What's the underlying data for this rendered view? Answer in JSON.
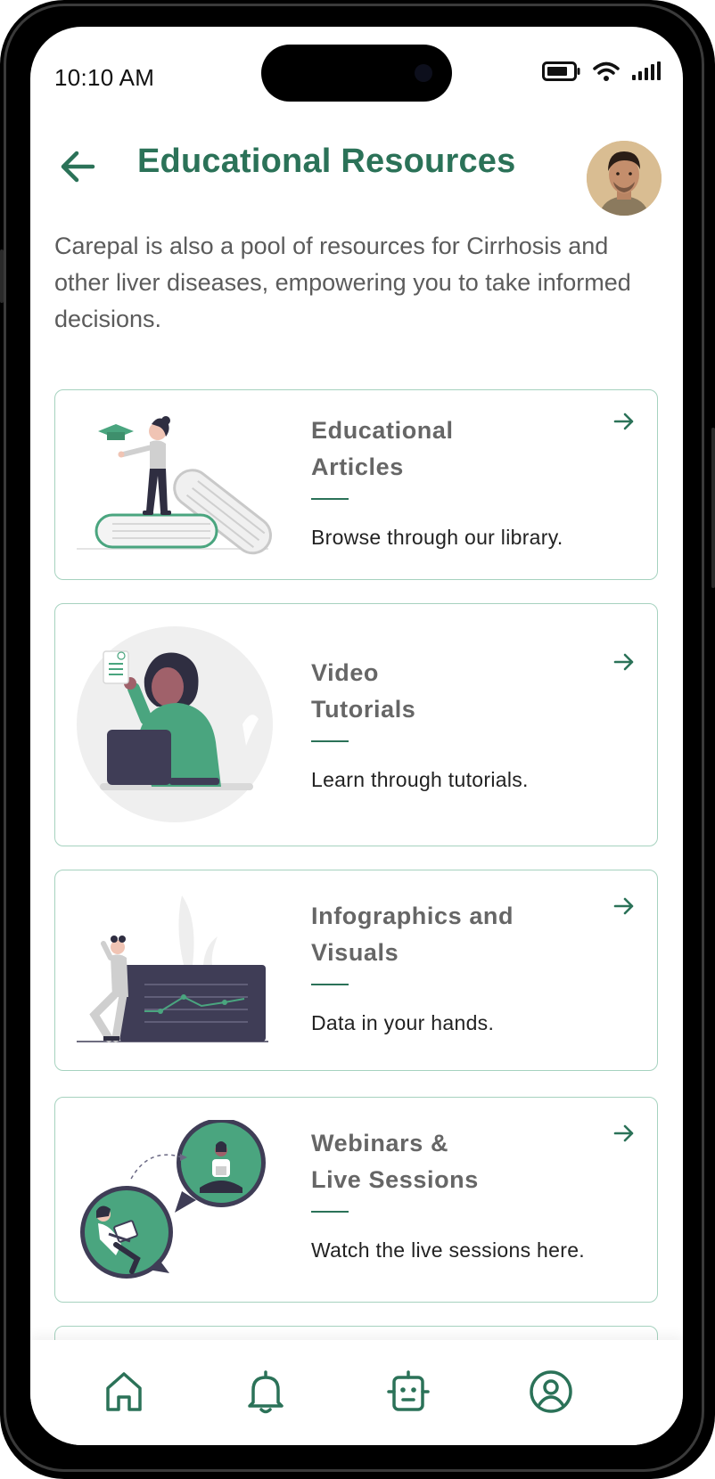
{
  "status": {
    "time": "10:10 AM"
  },
  "header": {
    "title": "Educational Resources"
  },
  "intro": "Carepal is also a pool of resources for Cirrhosis and other liver diseases, empowering you to take informed decisions.",
  "resources": [
    {
      "title_line1": "Educational",
      "title_line2": "Articles",
      "description": "Browse through our library."
    },
    {
      "title_line1": "Video",
      "title_line2": "Tutorials",
      "description": "Learn through tutorials."
    },
    {
      "title_line1": "Infographics and",
      "title_line2": "Visuals",
      "description": "Data in your hands."
    },
    {
      "title_line1": "Webinars &",
      "title_line2": "Live Sessions",
      "description": "Watch the live sessions here."
    }
  ],
  "bottom_nav": [
    "home-icon",
    "bell-icon",
    "robot-icon",
    "profile-icon"
  ],
  "colors": {
    "accent": "#2b7258",
    "card_border": "#a6d2bf",
    "illustration_green": "#4aa57f",
    "dark_slate": "#3f3d56"
  }
}
